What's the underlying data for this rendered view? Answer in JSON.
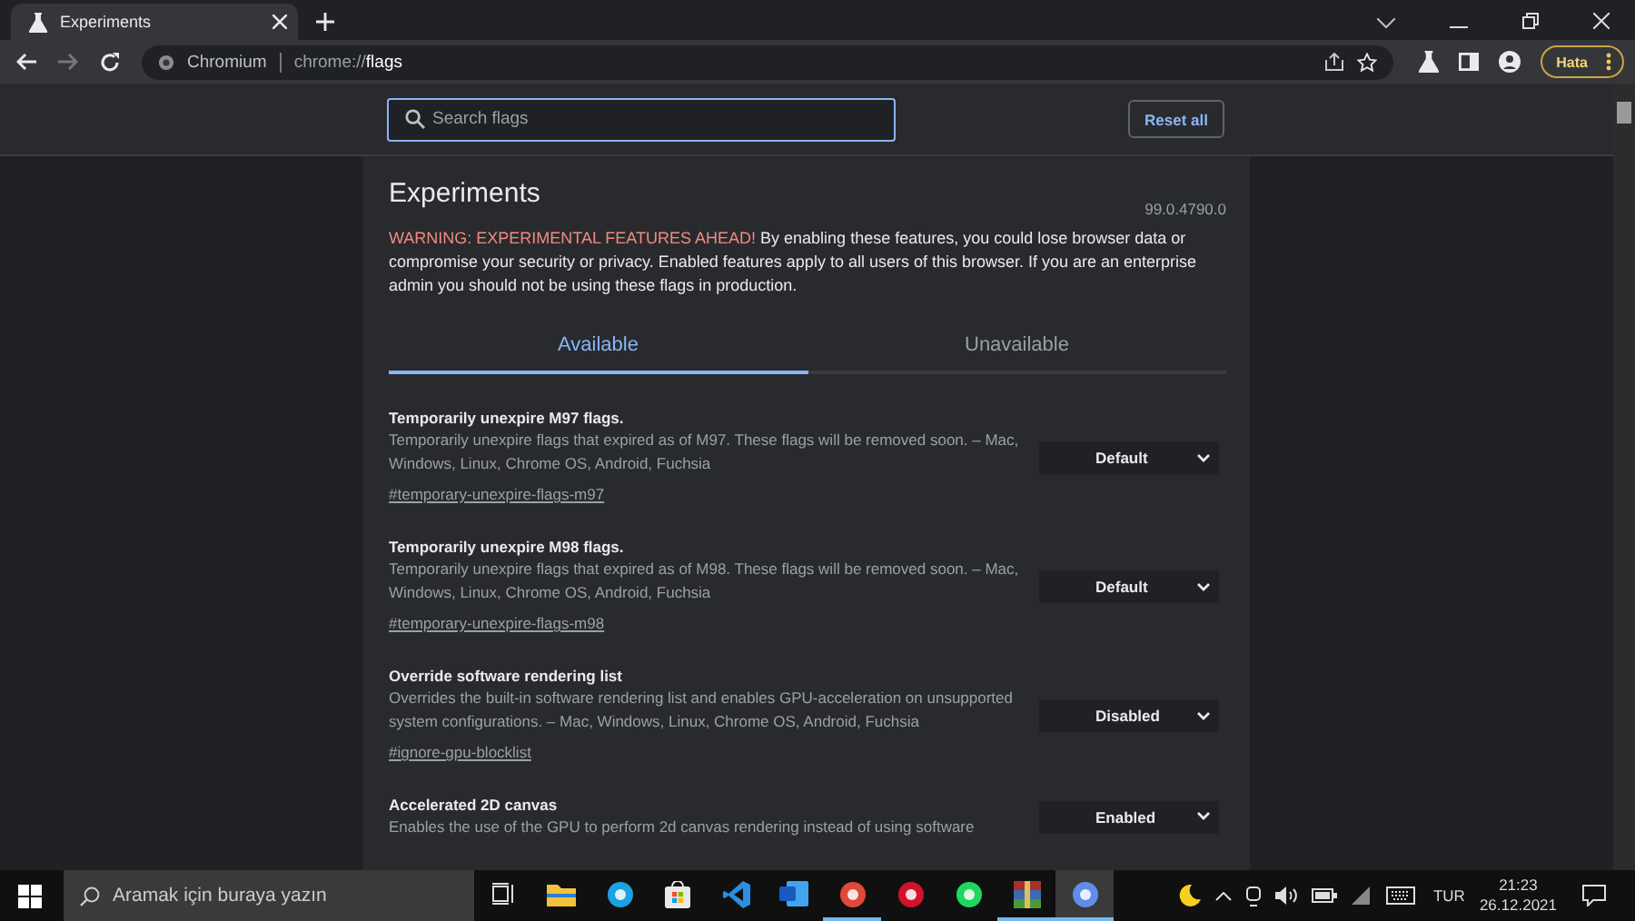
{
  "browser": {
    "tab_title": "Experiments",
    "site_label": "Chromium",
    "url_prefix": "chrome://",
    "url_path": "flags",
    "profile_label": "Hata"
  },
  "header": {
    "search": {
      "placeholder": "Search flags"
    },
    "reset_button": "Reset all"
  },
  "page": {
    "title": "Experiments",
    "version": "99.0.4790.0",
    "warning_lead": "WARNING: EXPERIMENTAL FEATURES AHEAD!",
    "warning_body": "By enabling these features, you could lose browser data or compromise your security or privacy. Enabled features apply to all users of this browser. If you are an enterprise admin you should not be using these flags in production.",
    "tabs": [
      {
        "label": "Available",
        "selected": true
      },
      {
        "label": "Unavailable",
        "selected": false
      }
    ],
    "flags": [
      {
        "title": "Temporarily unexpire M97 flags.",
        "description": "Temporarily unexpire flags that expired as of M97. These flags will be removed soon. – Mac, Windows, Linux, Chrome OS, Android, Fuchsia",
        "link": "#temporary-unexpire-flags-m97",
        "value": "Default"
      },
      {
        "title": "Temporarily unexpire M98 flags.",
        "description": "Temporarily unexpire flags that expired as of M98. These flags will be removed soon. – Mac, Windows, Linux, Chrome OS, Android, Fuchsia",
        "link": "#temporary-unexpire-flags-m98",
        "value": "Default"
      },
      {
        "title": "Override software rendering list",
        "description": "Overrides the built-in software rendering list and enables GPU-acceleration on unsupported system configurations. – Mac, Windows, Linux, Chrome OS, Android, Fuchsia",
        "link": "#ignore-gpu-blocklist",
        "value": "Disabled"
      },
      {
        "title": "Accelerated 2D canvas",
        "description": "Enables the use of the GPU to perform 2d canvas rendering instead of using software",
        "value": "Enabled"
      }
    ]
  },
  "taskbar": {
    "search_placeholder": "Aramak için buraya yazın",
    "apps": [
      {
        "kind": "taskview",
        "running": false,
        "selected": false
      },
      {
        "kind": "folder",
        "running": false,
        "selected": false
      },
      {
        "kind": "edge",
        "running": false,
        "selected": false
      },
      {
        "kind": "store",
        "running": false,
        "selected": false
      },
      {
        "kind": "code",
        "running": false,
        "selected": false
      },
      {
        "kind": "word",
        "running": false,
        "selected": false
      },
      {
        "kind": "chrome",
        "running": true,
        "selected": false
      },
      {
        "kind": "opera",
        "running": false,
        "selected": false
      },
      {
        "kind": "spotify",
        "running": false,
        "selected": false
      },
      {
        "kind": "archive",
        "running": true,
        "selected": false
      },
      {
        "kind": "chromium",
        "running": true,
        "selected": true
      }
    ],
    "language": "TUR",
    "time": "21:23",
    "date": "26.12.2021"
  }
}
